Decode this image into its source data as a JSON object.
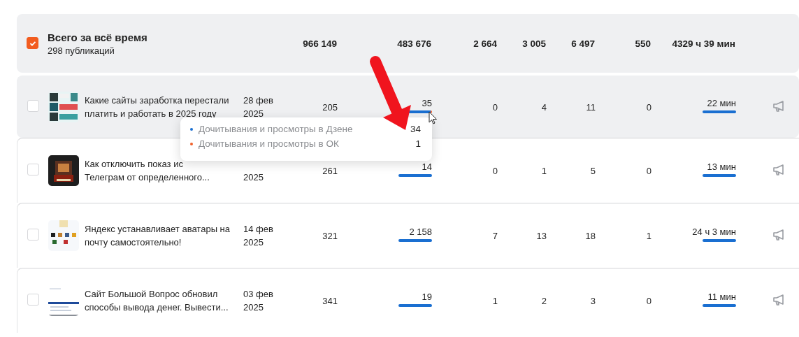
{
  "summary": {
    "checked": true,
    "title": "Всего за всё время",
    "subtitle": "298 публикаций",
    "values": [
      "966 149",
      "483 676",
      "2 664",
      "3 005",
      "6 497",
      "550"
    ],
    "time": "4329 ч 39 мин"
  },
  "rows": [
    {
      "checked": false,
      "hovered": true,
      "title_lines": [
        "Какие сайты заработка перестали",
        "платить и работать в 2025 году"
      ],
      "date_lines": [
        "28 фев",
        "2025"
      ],
      "views": "205",
      "reads": "35",
      "reads_bar": {
        "level": 0.95
      },
      "stats": [
        "0",
        "4",
        "11",
        "0"
      ],
      "time": "22 мин",
      "time_bar": {
        "level": 1
      }
    },
    {
      "checked": false,
      "hovered": false,
      "title_lines": [
        "Как отключить показ ис",
        "Телеграм от определенного..."
      ],
      "date_lines": [
        "2025"
      ],
      "views": "261",
      "reads": "14",
      "reads_bar": {
        "level": 1
      },
      "stats": [
        "0",
        "1",
        "5",
        "0"
      ],
      "time": "13 мин",
      "time_bar": {
        "level": 1
      }
    },
    {
      "checked": false,
      "hovered": false,
      "title_lines": [
        "Яндекс устанавливает аватары на",
        "почту самостоятельно!"
      ],
      "date_lines": [
        "14 фев",
        "2025"
      ],
      "views": "321",
      "reads": "2 158",
      "reads_bar": {
        "level": 1
      },
      "stats": [
        "7",
        "13",
        "18",
        "1"
      ],
      "time": "24 ч 3 мин",
      "time_bar": {
        "level": 1
      }
    },
    {
      "checked": false,
      "hovered": false,
      "title_lines": [
        "Сайт Большой Вопрос обновил",
        "способы вывода денег. Вывести..."
      ],
      "date_lines": [
        "03 фев",
        "2025"
      ],
      "views": "341",
      "reads": "19",
      "reads_bar": {
        "level": 1
      },
      "stats": [
        "1",
        "2",
        "3",
        "0"
      ],
      "time": "11 мин",
      "time_bar": {
        "level": 1
      }
    }
  ],
  "tooltip": {
    "items": [
      {
        "label": "Дочитывания и просмотры в Дзене",
        "value": "34",
        "color": "#1a6fd1"
      },
      {
        "label": "Дочитывания и просмотры в ОК",
        "value": "1",
        "color": "#f0602a"
      }
    ]
  }
}
